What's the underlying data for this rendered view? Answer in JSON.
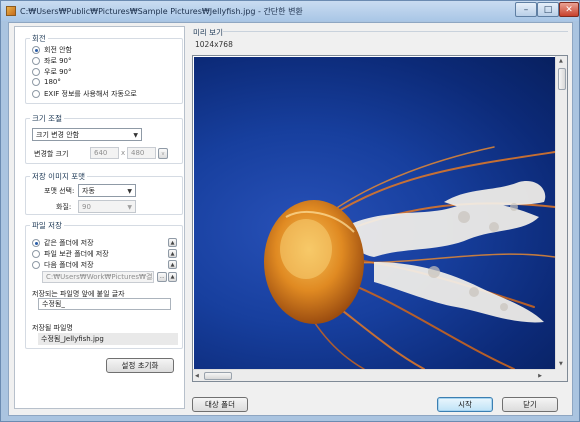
{
  "window": {
    "title": "C:₩Users₩Public₩Pictures₩Sample Pictures₩Jellyfish.jpg - 간단한 변환",
    "minimize": "–",
    "maximize": "□",
    "close": "✕"
  },
  "rotation": {
    "legend": "회전",
    "options": [
      "회전 안함",
      "좌로 90°",
      "우로 90°",
      "180°",
      "EXIF 정보를 사용해서 자동으로"
    ],
    "selected_index": 0
  },
  "resize": {
    "legend": "크기 조절",
    "mode_value": "크기 변경 안함",
    "target_label": "변경할 크기",
    "width_value": "640",
    "separator": "x",
    "height_value": "480",
    "lock_glyph": "v"
  },
  "format": {
    "legend": "저장 이미지 포맷",
    "format_label": "포맷 선택:",
    "format_value": "자동",
    "quality_label": "화질:",
    "quality_value": "90"
  },
  "save": {
    "legend": "파일 저장",
    "options": [
      "같은 폴더에 저장",
      "파일 보관 폴더에 저장",
      "다음 폴더에 저장"
    ],
    "selected_index": 0,
    "folder_path": "C:₩Users₩Work₩Pictures₩결과",
    "browse_label": "...",
    "prefix_label": "저장되는 파일명 앞에 붙일 글자",
    "prefix_value": "수정됨_",
    "filename_label": "저장될 파일명",
    "filename_value": "수정됨_Jellyfish.jpg"
  },
  "reset_button": "설정 초기화",
  "preview": {
    "label": "미리 보기",
    "dimensions": "1024x768"
  },
  "footer": {
    "target_folder_button": "대상 폴더",
    "start_button": "시작",
    "close_button": "닫기"
  },
  "colors": {
    "accent": "#3c7fb1",
    "photo_background": "#173f9e",
    "jellyfish": "#e08a22"
  }
}
